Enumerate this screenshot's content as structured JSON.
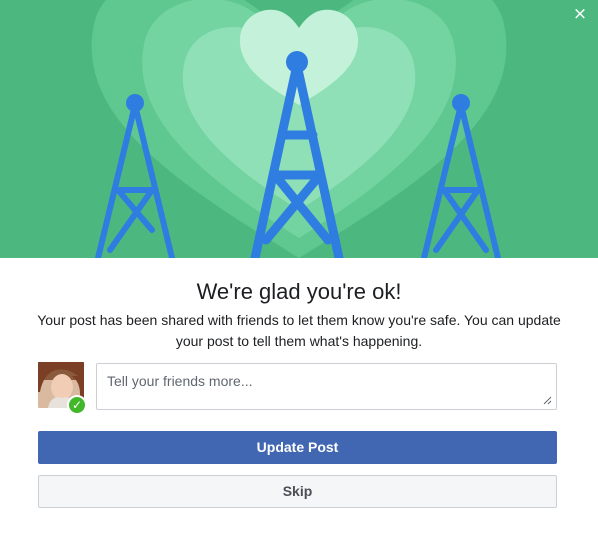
{
  "dialog": {
    "close_label": "×",
    "title": "We're glad you're ok!",
    "description": "Your post has been shared with friends to let them know you're safe. You can update your post to tell them what's happening."
  },
  "composer": {
    "placeholder": "Tell your friends more...",
    "value": ""
  },
  "avatar": {
    "status_icon": "checkmark-icon",
    "status_glyph": "✓",
    "status_color": "#42b72a"
  },
  "actions": {
    "update_label": "Update Post",
    "skip_label": "Skip"
  },
  "colors": {
    "hero_green": "#4cb87f",
    "heart_green": "#a8ebc6",
    "tower_blue": "#2f7de1",
    "primary_button": "#4267b2"
  }
}
